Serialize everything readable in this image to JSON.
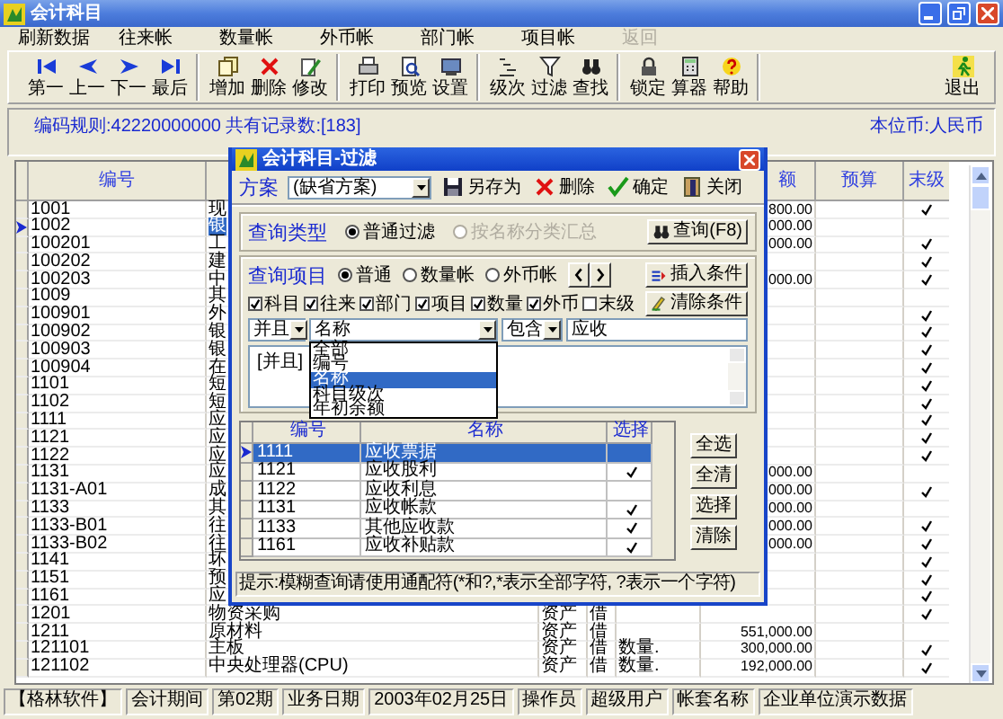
{
  "window": {
    "title": "会计科目"
  },
  "menu": [
    {
      "label": "刷新数据",
      "disabled": false
    },
    {
      "label": "往来帐",
      "disabled": false
    },
    {
      "label": "数量帐",
      "disabled": false
    },
    {
      "label": "外币帐",
      "disabled": false
    },
    {
      "label": "部门帐",
      "disabled": false
    },
    {
      "label": "项目帐",
      "disabled": false
    },
    {
      "label": "返回",
      "disabled": true
    }
  ],
  "toolbar": {
    "groups": [
      [
        {
          "label": "第一",
          "kind": "first"
        },
        {
          "label": "上一",
          "kind": "prev"
        },
        {
          "label": "下一",
          "kind": "next"
        },
        {
          "label": "最后",
          "kind": "last"
        }
      ],
      [
        {
          "label": "增加",
          "kind": "add"
        },
        {
          "label": "删除",
          "kind": "delete"
        },
        {
          "label": "修改",
          "kind": "edit"
        }
      ],
      [
        {
          "label": "打印",
          "kind": "print"
        },
        {
          "label": "预览",
          "kind": "preview"
        },
        {
          "label": "设置",
          "kind": "setup"
        }
      ],
      [
        {
          "label": "级次",
          "kind": "level"
        },
        {
          "label": "过滤",
          "kind": "filter"
        },
        {
          "label": "查找",
          "kind": "find"
        }
      ],
      [
        {
          "label": "锁定",
          "kind": "lock"
        },
        {
          "label": "算器",
          "kind": "calc"
        },
        {
          "label": "帮助",
          "kind": "help"
        }
      ]
    ],
    "exit": {
      "label": "退出",
      "kind": "exit"
    }
  },
  "info": {
    "summary": "编码规则:42220000000 共有记录数:[183]",
    "currency": "本位币:人民币"
  },
  "table": {
    "columns": {
      "code": "编号",
      "balance": "额",
      "budget": "预算",
      "leaf": "末级"
    },
    "rows": [
      {
        "code": "1001",
        "name": "现",
        "balance": "800.00",
        "leaf": true,
        "selected": false
      },
      {
        "code": "1002",
        "name": "银",
        "balance": "000.00",
        "leaf": false,
        "selected": true
      },
      {
        "code": "100201",
        "name": "工",
        "balance": "000.00",
        "leaf": true,
        "selected": false
      },
      {
        "code": "100202",
        "name": "建",
        "leaf": true,
        "selected": false
      },
      {
        "code": "100203",
        "name": "中",
        "balance": "000.00",
        "leaf": true,
        "selected": false
      },
      {
        "code": "1009",
        "name": "其",
        "leaf": false,
        "selected": false
      },
      {
        "code": "100901",
        "name": "外",
        "leaf": true,
        "selected": false
      },
      {
        "code": "100902",
        "name": "银",
        "leaf": true,
        "selected": false
      },
      {
        "code": "100903",
        "name": "银",
        "leaf": true,
        "selected": false
      },
      {
        "code": "100904",
        "name": "在",
        "leaf": true,
        "selected": false
      },
      {
        "code": "1101",
        "name": "短",
        "leaf": true,
        "selected": false
      },
      {
        "code": "1102",
        "name": "短",
        "leaf": true,
        "selected": false
      },
      {
        "code": "1111",
        "name": "应",
        "leaf": true,
        "selected": false
      },
      {
        "code": "1121",
        "name": "应",
        "leaf": true,
        "selected": false
      },
      {
        "code": "1122",
        "name": "应",
        "leaf": true,
        "selected": false
      },
      {
        "code": "1131",
        "name": "应",
        "balance": "000.00",
        "leaf": false,
        "selected": false
      },
      {
        "code": "1131-A01",
        "name": "成",
        "balance": "000.00",
        "leaf": true,
        "selected": false
      },
      {
        "code": "1133",
        "name": "其",
        "balance": "000.00",
        "leaf": false,
        "selected": false
      },
      {
        "code": "1133-B01",
        "name": "往",
        "balance": "000.00",
        "leaf": true,
        "selected": false
      },
      {
        "code": "1133-B02",
        "name": "往",
        "balance": "000.00",
        "leaf": true,
        "selected": false
      },
      {
        "code": "1141",
        "name": "坏",
        "leaf": true,
        "selected": false
      },
      {
        "code": "1151",
        "name": "预",
        "leaf": true,
        "selected": false
      },
      {
        "code": "1161",
        "name": "应",
        "leaf": true,
        "selected": false
      },
      {
        "code": "1201",
        "name": "物资采购",
        "type": "资产",
        "direction": "借",
        "leaf": true,
        "selected": false
      },
      {
        "code": "1211",
        "name": "原材料",
        "type": "资产",
        "direction": "借",
        "balance": "551,000.00",
        "leaf": false,
        "selected": false
      },
      {
        "code": "121101",
        "name": "主板",
        "type": "资产",
        "direction": "借",
        "unit": "数量.",
        "balance": "300,000.00",
        "leaf": true,
        "selected": false
      },
      {
        "code": "121102",
        "name": "中央处理器(CPU)",
        "type": "资产",
        "direction": "借",
        "unit": "数量.",
        "balance": "192,000.00",
        "leaf": true,
        "selected": false
      }
    ]
  },
  "status_bar": [
    "【格林软件】",
    "会计期间",
    "第02期",
    "业务日期",
    "2003年02月25日",
    "操作员",
    "超级用户",
    "帐套名称",
    "企业单位演示数据"
  ],
  "dialog": {
    "title": "会计科目-过滤",
    "scheme": {
      "label": "方案",
      "value": "(缺省方案)"
    },
    "actions": [
      {
        "label": "另存为",
        "kind": "save"
      },
      {
        "label": "删除",
        "kind": "delete"
      },
      {
        "label": "确定",
        "kind": "ok"
      },
      {
        "label": "关闭",
        "kind": "close"
      }
    ],
    "query_type": {
      "label": "查询类型",
      "options": [
        {
          "label": "普通过滤",
          "selected": true,
          "disabled": false
        },
        {
          "label": "按名称分类汇总",
          "selected": false,
          "disabled": true
        }
      ],
      "button": "查询(F8)"
    },
    "query_items": {
      "label": "查询项目",
      "modes": [
        {
          "label": "普通",
          "selected": true
        },
        {
          "label": "数量帐",
          "selected": false
        },
        {
          "label": "外币帐",
          "selected": false
        }
      ],
      "insert_button": "插入条件",
      "clear_button": "清除条件",
      "fields": [
        {
          "label": "科目",
          "checked": true
        },
        {
          "label": "往来",
          "checked": true
        },
        {
          "label": "部门",
          "checked": true
        },
        {
          "label": "项目",
          "checked": true
        },
        {
          "label": "数量",
          "checked": true
        },
        {
          "label": "外币",
          "checked": true
        },
        {
          "label": "末级",
          "checked": false
        }
      ]
    },
    "condition": {
      "logic": "并且",
      "field": "名称",
      "operator": "包含",
      "value": "应收"
    },
    "condition_list": [
      "[并且]"
    ],
    "field_dropdown": [
      {
        "label": "全部",
        "selected": false
      },
      {
        "label": "编号",
        "selected": false
      },
      {
        "label": "名称",
        "selected": true
      },
      {
        "label": "科目级次",
        "selected": false
      },
      {
        "label": "年初余额",
        "selected": false
      }
    ],
    "results": {
      "columns": [
        "编号",
        "名称",
        "选择"
      ],
      "rows": [
        {
          "code": "1111",
          "name": "应收票据",
          "chosen": false,
          "selected": true
        },
        {
          "code": "1121",
          "name": "应收股利",
          "chosen": true,
          "selected": false
        },
        {
          "code": "1122",
          "name": "应收利息",
          "chosen": false,
          "selected": false
        },
        {
          "code": "1131",
          "name": "应收帐款",
          "chosen": true,
          "selected": false
        },
        {
          "code": "1133",
          "name": "其他应收款",
          "chosen": true,
          "selected": false
        },
        {
          "code": "1161",
          "name": "应收补贴款",
          "chosen": true,
          "selected": false
        }
      ]
    },
    "result_buttons": [
      "全选",
      "全清",
      "选择",
      "清除"
    ],
    "hint": "提示:模糊查询请使用通配符(*和?,*表示全部字符, ?表示一个字符)"
  }
}
